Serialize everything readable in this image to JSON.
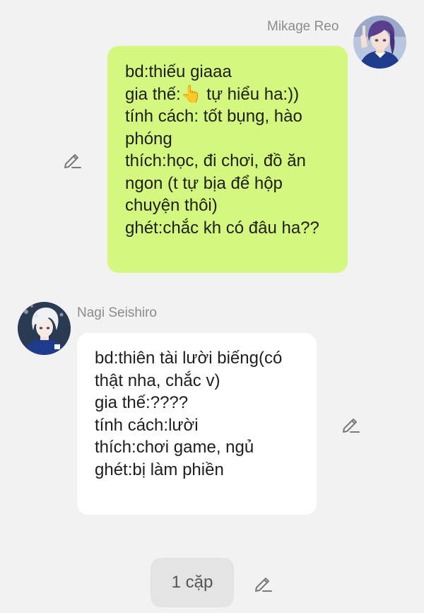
{
  "messages": [
    {
      "sender": "Mikage Reo",
      "side": "right",
      "bubble_color": "#d4f77f",
      "avatar_icon": "purple-haired-character-avatar",
      "text": "bd:thiếu giaaa\ngia thế:👆 tự hiểu ha:))\ntính cách: tốt bụng, hào phóng\nthích:học, đi chơi, đồ ăn ngon (t tự bịa để hộp chuyện thôi)\nghét:chắc kh có đâu ha??"
    },
    {
      "sender": "Nagi Seishiro",
      "side": "left",
      "bubble_color": "#ffffff",
      "avatar_icon": "white-haired-character-avatar",
      "text": "bd:thiên tài lười biếng(có thật nha, chắc v)\ngia thế:????\ntính cách:lười\nthích:chơi game, ngủ\nghét:bị làm phiền"
    }
  ],
  "choice": {
    "label": "1 cặp"
  },
  "icons": {
    "edit": "pencil-edit-icon"
  },
  "colors": {
    "background": "#f2f2f2",
    "name_text": "#8c8c8c",
    "pill_bg": "#e4e4e4"
  }
}
